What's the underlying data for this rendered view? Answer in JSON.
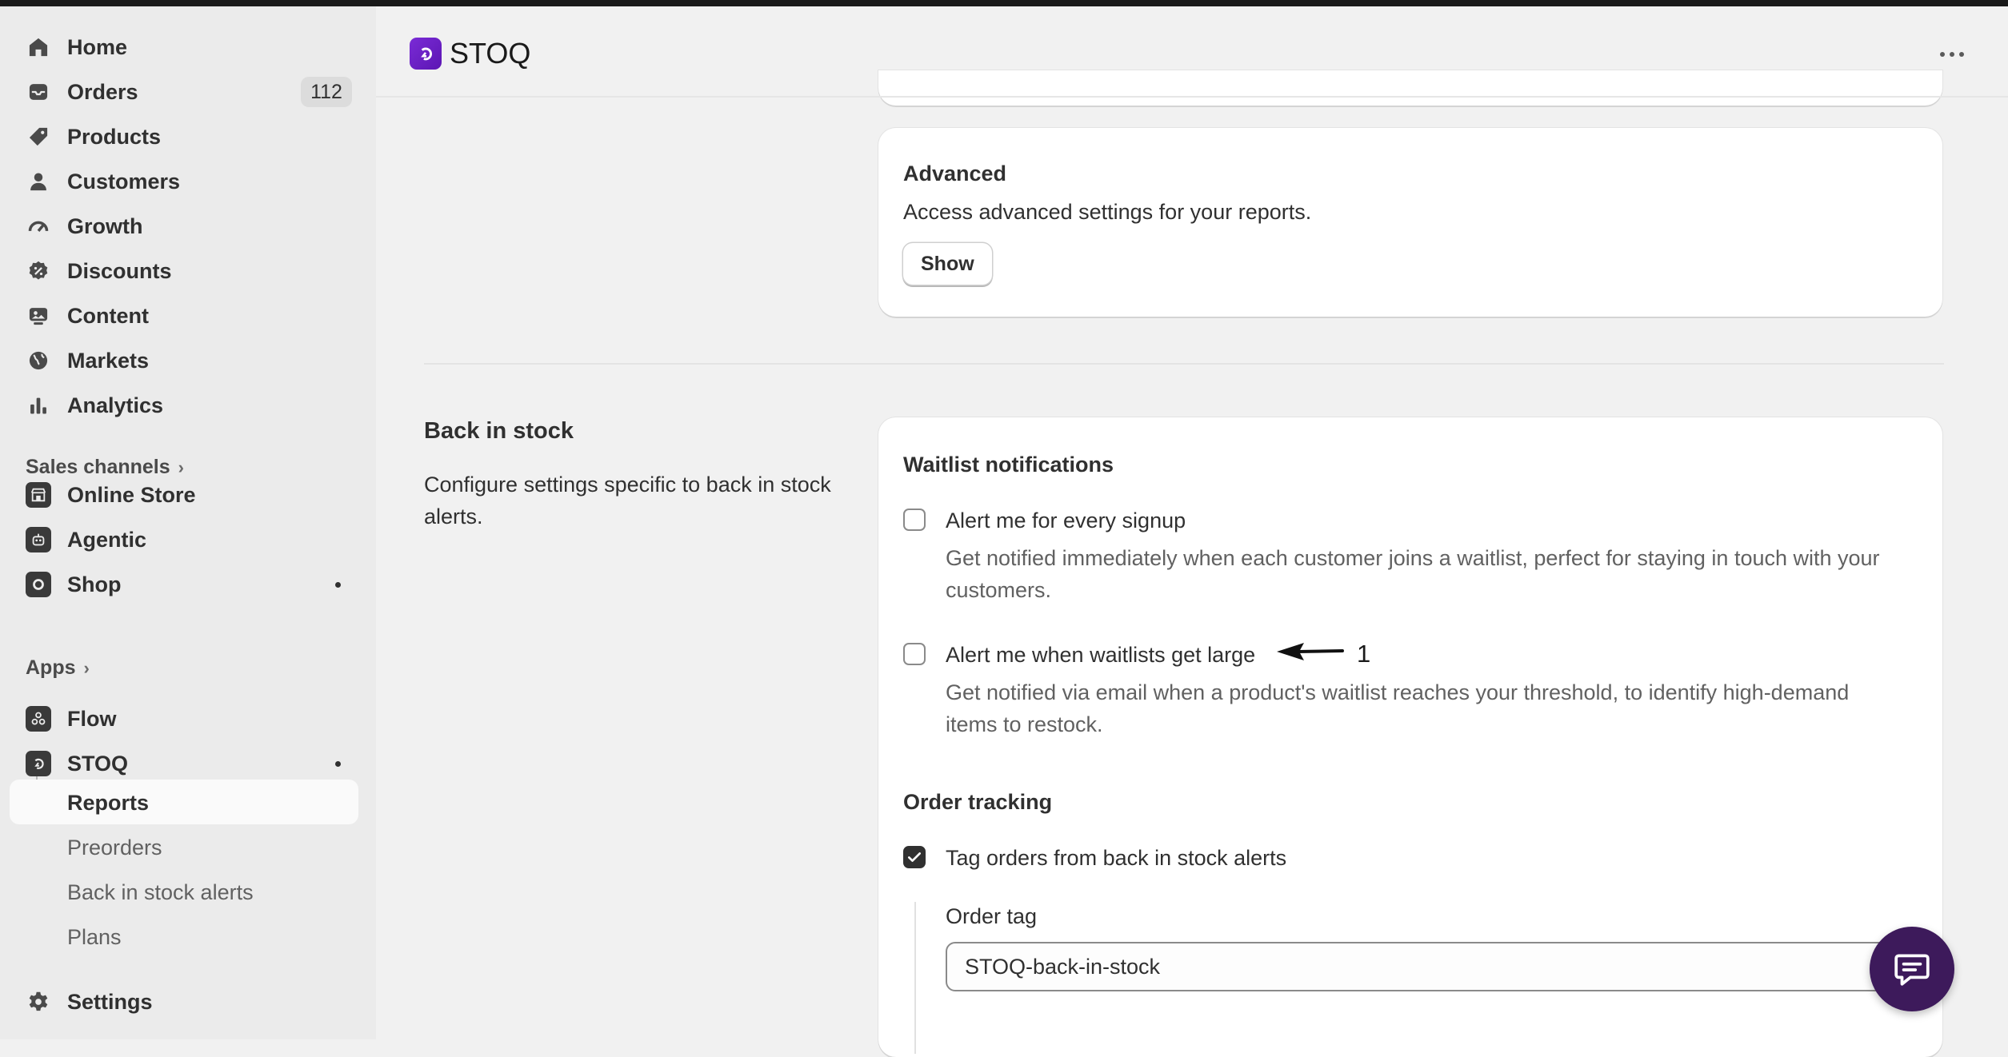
{
  "nav": {
    "home": "Home",
    "orders": "Orders",
    "orders_count": "112",
    "products": "Products",
    "customers": "Customers",
    "growth": "Growth",
    "discounts": "Discounts",
    "content": "Content",
    "markets": "Markets",
    "analytics": "Analytics"
  },
  "sales_channels": {
    "label": "Sales channels",
    "online_store": "Online Store",
    "agentic": "Agentic",
    "shop": "Shop"
  },
  "apps": {
    "label": "Apps",
    "flow": "Flow",
    "stoq": "STOQ",
    "stoq_sub": [
      "Reports",
      "Preorders",
      "Back in stock alerts",
      "Plans"
    ],
    "active_sub": "Reports"
  },
  "settings": "Settings",
  "header": {
    "app_name": "STOQ"
  },
  "advanced": {
    "title": "Advanced",
    "description": "Access advanced settings for your reports.",
    "show_button": "Show"
  },
  "back_in_stock": {
    "title": "Back in stock",
    "description": "Configure settings specific to back in stock alerts.",
    "waitlist_heading": "Waitlist notifications",
    "alert_every_signup": {
      "label": "Alert me for every signup",
      "help": "Get notified immediately when each customer joins a waitlist, perfect for staying in touch with your customers.",
      "checked": false
    },
    "alert_large": {
      "label": "Alert me when waitlists get large",
      "help": "Get notified via email when a product's waitlist reaches your threshold, to identify high-demand items to restock.",
      "checked": false
    },
    "annotation": "1",
    "order_tracking_heading": "Order tracking",
    "tag_orders": {
      "label": "Tag orders from back in stock alerts",
      "checked": true
    },
    "order_tag_label": "Order tag",
    "order_tag_value": "STOQ-back-in-stock"
  },
  "colors": {
    "accent": "#6b21c8",
    "chat": "#3d1a5b"
  }
}
